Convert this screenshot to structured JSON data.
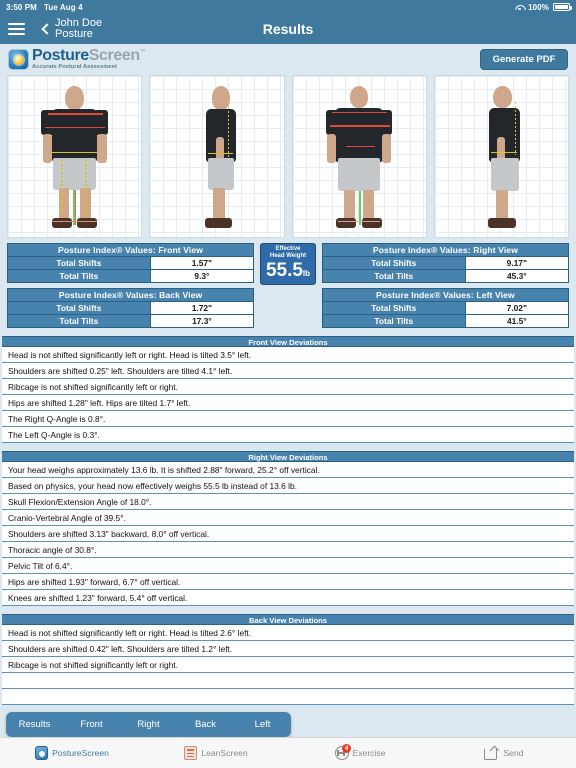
{
  "status_bar": {
    "time": "3:50 PM",
    "date": "Tue Aug 4",
    "battery": "100%",
    "wifi_icon": "wifi-icon",
    "battery_icon": "battery-full-icon"
  },
  "nav": {
    "menu_icon": "hamburger-menu-icon",
    "back_icon": "chevron-left-icon",
    "back_line1": "John Doe",
    "back_line2": "Posture",
    "title": "Results"
  },
  "brand": {
    "logo_icon": "posturescreen-logo-icon",
    "name_bold": "Posture",
    "name_light": "Screen",
    "trademark": "™",
    "tagline": "Accurate Postural Assessment",
    "generate_pdf_label": "Generate PDF"
  },
  "photos": [
    {
      "name": "front-view-photo",
      "view": "Front View"
    },
    {
      "name": "right-view-photo",
      "view": "Right View"
    },
    {
      "name": "back-view-photo",
      "view": "Back View"
    },
    {
      "name": "left-view-photo",
      "view": "Left View"
    }
  ],
  "effective_head_weight": {
    "label_line1": "Effective",
    "label_line2": "Head Weight",
    "value": "55.5",
    "unit": "lb"
  },
  "index_tables": [
    {
      "name": "posture-index-front-view",
      "title": "Posture Index® Values: Front View",
      "rows": [
        {
          "label": "Total Shifts",
          "value": "1.57\""
        },
        {
          "label": "Total Tilts",
          "value": "9.3°"
        }
      ]
    },
    {
      "name": "posture-index-back-view",
      "title": "Posture Index® Values: Back View",
      "rows": [
        {
          "label": "Total Shifts",
          "value": "1.72\""
        },
        {
          "label": "Total Tilts",
          "value": "17.3°"
        }
      ]
    },
    {
      "name": "posture-index-right-view",
      "title": "Posture Index® Values: Right View",
      "rows": [
        {
          "label": "Total Shifts",
          "value": "9.17\""
        },
        {
          "label": "Total Tilts",
          "value": "45.3°"
        }
      ]
    },
    {
      "name": "posture-index-left-view",
      "title": "Posture Index® Values: Left View",
      "rows": [
        {
          "label": "Total Shifts",
          "value": "7.02\""
        },
        {
          "label": "Total Tilts",
          "value": "41.5°"
        }
      ]
    }
  ],
  "deviations": [
    {
      "name": "front-view-deviations",
      "header": "Front View Deviations",
      "rows": [
        "Head is not shifted significantly left or right. Head is tilted 3.5° left.",
        "Shoulders are shifted 0.25\" left. Shoulders are tilted 4.1° left.",
        "Ribcage is not shifted significantly left or right.",
        "Hips are shifted 1.28\" left. Hips are tilted 1.7° left.",
        "The Right Q-Angle is 0.8°.",
        "The Left Q-Angle is 0.3°."
      ]
    },
    {
      "name": "right-view-deviations",
      "header": "Right View Deviations",
      "rows": [
        "Your head weighs approximately 13.6 lb. It is shifted 2.88\" forward, 25.2° off vertical.",
        "Based on physics, your head now effectively weighs 55.5 lb instead of 13.6 lb.",
        "Skull Flexion/Extension Angle of 18.0°.",
        "Cranio-Vertebral Angle of 39.5°.",
        "Shoulders are shifted 3.13\" backward, 8.0° off vertical.",
        "Thoracic angle of 30.8°.",
        "Pelvic Tilt of 6.4°.",
        "Hips are shifted 1.93\" forward, 6.7° off vertical.",
        "Knees are shifted 1.23\" forward, 5.4° off vertical."
      ]
    },
    {
      "name": "back-view-deviations",
      "header": "Back View Deviations",
      "rows": [
        "Head is not shifted significantly left or right. Head is tilted 2.6° left.",
        "Shoulders are shifted 0.42\" left. Shoulders are tilted 1.2° left.",
        "Ribcage is not shifted significantly left or right.",
        "",
        ""
      ]
    }
  ],
  "segmented_tabs": {
    "selected": "Results",
    "items": [
      "Results",
      "Front",
      "Right",
      "Back",
      "Left"
    ]
  },
  "toolbar": {
    "items": [
      {
        "name": "tab-posturescreen",
        "label": "PostureScreen",
        "icon": "posturescreen-icon",
        "active": true,
        "badge": ""
      },
      {
        "name": "tab-leanscreen",
        "label": "LeanScreen",
        "icon": "leanscreen-icon",
        "active": false,
        "badge": ""
      },
      {
        "name": "tab-exercise",
        "label": "Exercise",
        "icon": "exercise-icon",
        "active": false,
        "badge": "4"
      },
      {
        "name": "tab-send",
        "label": "Send",
        "icon": "send-icon",
        "active": false,
        "badge": ""
      }
    ]
  },
  "colors": {
    "nav_blue": "#3f7a9e",
    "table_blue": "#4883ad",
    "page_bg": "#dce8f0",
    "ehw_blue": "#2f6ba8",
    "badge_red": "#e8392a"
  }
}
